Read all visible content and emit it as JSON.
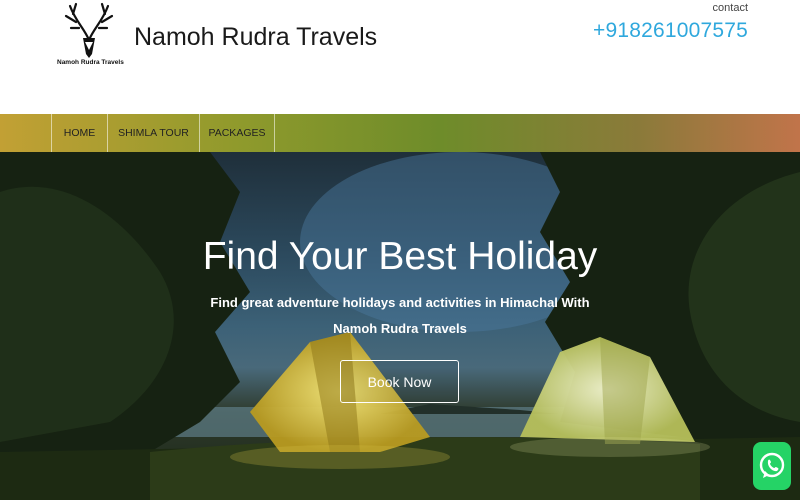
{
  "header": {
    "logo_text": "Namoh Rudra Travels",
    "brand": "Namoh Rudra Travels",
    "contact_label": "contact",
    "phone": "+918261007575"
  },
  "nav": {
    "items": [
      {
        "label": "HOME"
      },
      {
        "label": "SHIMLA TOUR"
      },
      {
        "label": "PACKAGES"
      }
    ]
  },
  "hero": {
    "title": "Find Your Best Holiday",
    "subtitle_line1": "Find great adventure holidays and activities in Himachal With",
    "subtitle_line2": "Namoh Rudra Travels",
    "button_label": "Book Now"
  },
  "floating": {
    "whatsapp_icon": "whatsapp-icon"
  },
  "colors": {
    "phone": "#2fa8dd",
    "whatsapp": "#25d366"
  }
}
